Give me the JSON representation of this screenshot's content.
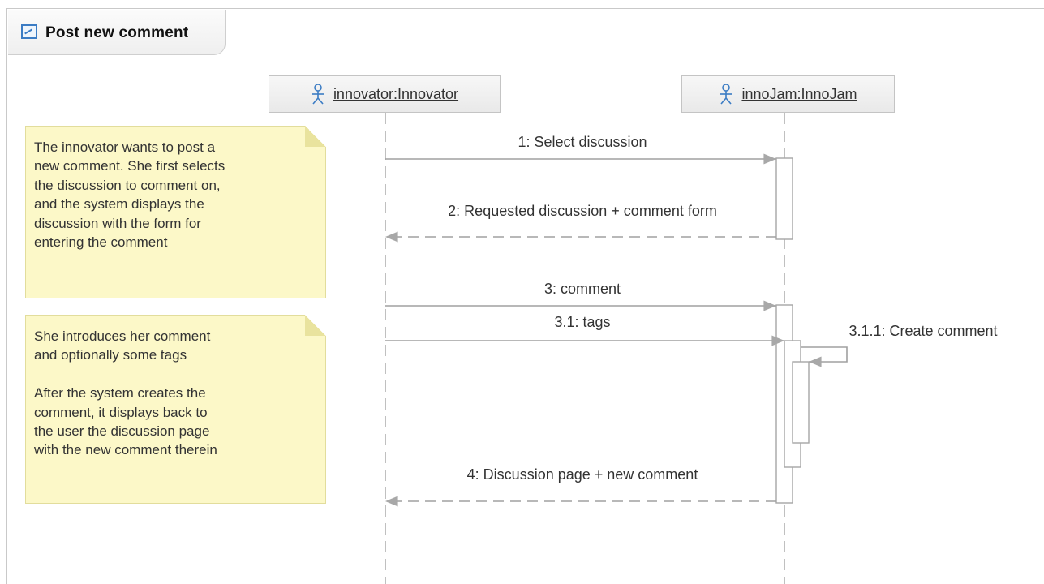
{
  "frame": {
    "title": "Post new comment"
  },
  "lifelines": [
    {
      "label": "innovator:Innovator",
      "icon": "actor-icon"
    },
    {
      "label": "innoJam:InnoJam",
      "icon": "actor-icon"
    }
  ],
  "notes": [
    {
      "text": "The innovator wants to post a\nnew comment. She first selects\nthe discussion to comment on,\nand the system displays the\ndiscussion with the form for\nentering the comment"
    },
    {
      "text": "She introduces her comment\nand optionally some tags\n\nAfter the system creates the\ncomment, it displays back to\nthe user the discussion page\nwith the new comment therein"
    }
  ],
  "messages": [
    {
      "label": "1: Select discussion"
    },
    {
      "label": "2: Requested discussion + comment form"
    },
    {
      "label": "3: comment"
    },
    {
      "label": "3.1: tags"
    },
    {
      "label": "3.1.1: Create comment"
    },
    {
      "label": "4: Discussion page + new comment"
    }
  ],
  "colors": {
    "line": "#9a9a9a",
    "note_fill": "#fcf8c8",
    "actor": "#3b7cc4"
  }
}
